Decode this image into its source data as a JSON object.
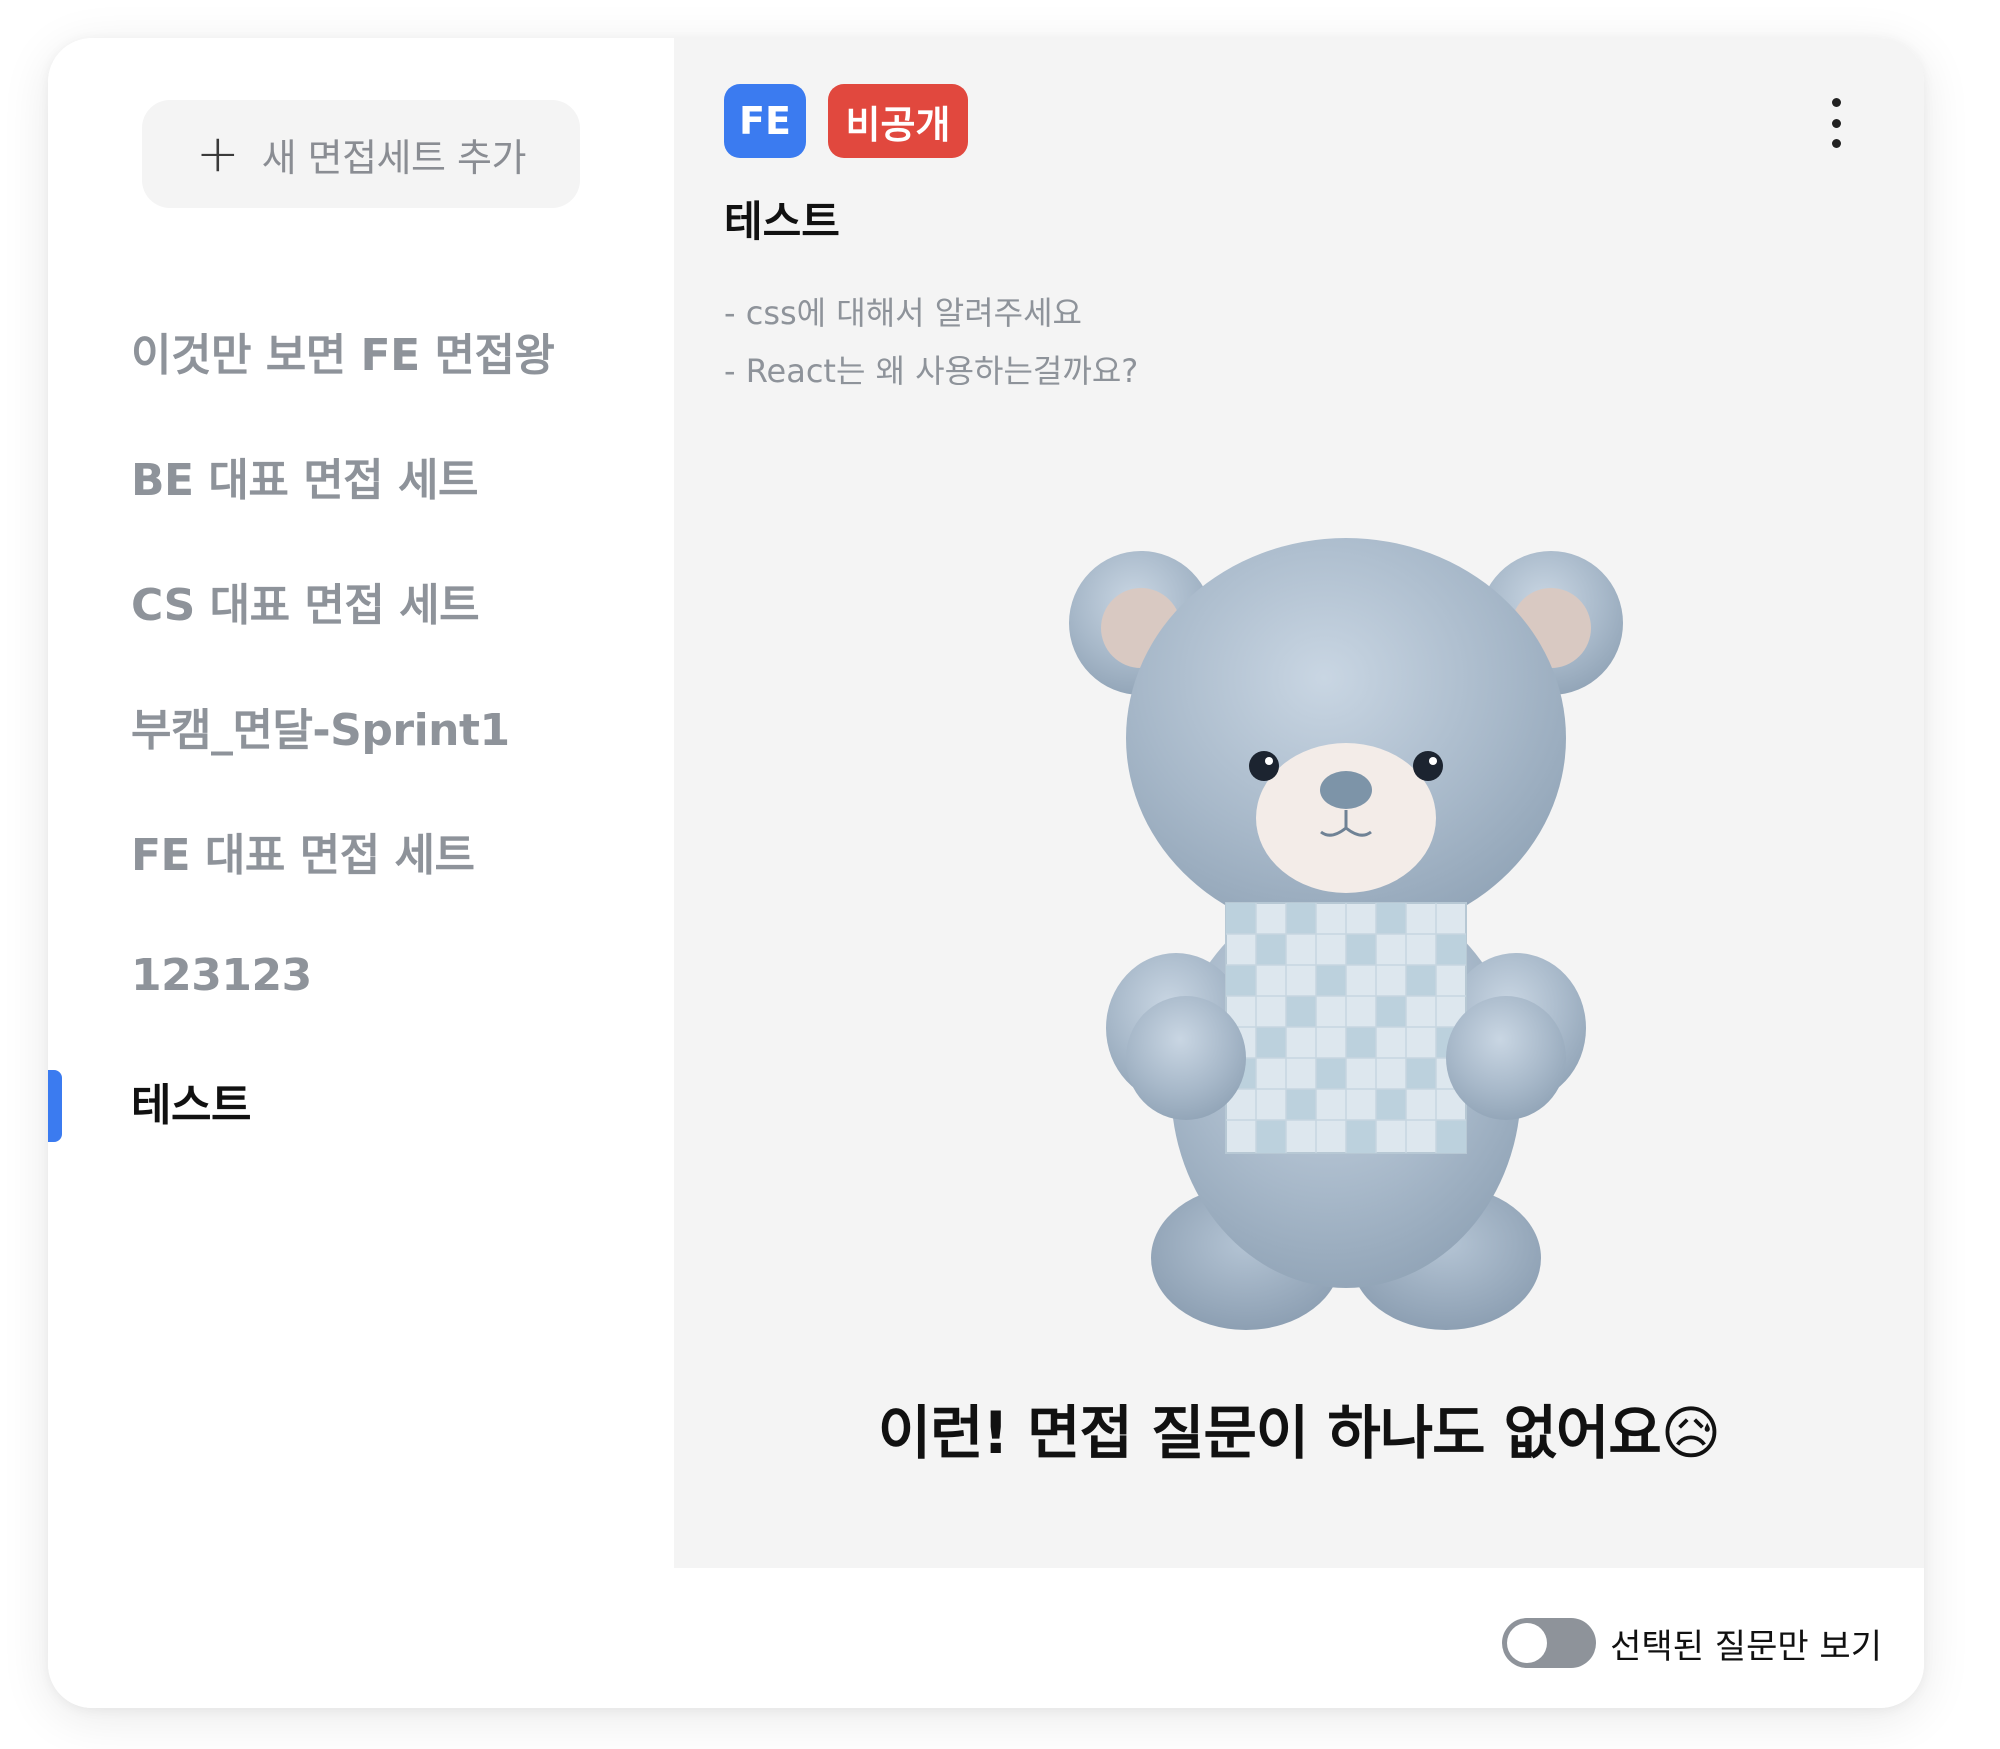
{
  "sidebar": {
    "add_button_label": "새 면접세트 추가",
    "items": [
      {
        "label": "이것만 보면 FE 면접왕",
        "active": false
      },
      {
        "label": "BE 대표 면접 세트",
        "active": false
      },
      {
        "label": "CS 대표 면접 세트",
        "active": false
      },
      {
        "label": "부캠_면달-Sprint1",
        "active": false
      },
      {
        "label": "FE 대표 면접 세트",
        "active": false
      },
      {
        "label": "123123",
        "active": false
      },
      {
        "label": "테스트",
        "active": true
      }
    ]
  },
  "main": {
    "tags": {
      "category": "FE",
      "visibility": "비공개"
    },
    "title": "테스트",
    "description_lines": [
      "- css에 대해서 알려주세요",
      "- React는 왜 사용하는걸까요?"
    ],
    "empty_message": "이런! 면접 질문이 하나도 없어요😥"
  },
  "footer": {
    "toggle_label": "선택된 질문만 보기",
    "toggle_on": false
  },
  "colors": {
    "accent": "#3b7bf0",
    "private_tag": "#e1483e",
    "panel_bg": "#f4f4f4",
    "muted_text": "#8e939a"
  }
}
